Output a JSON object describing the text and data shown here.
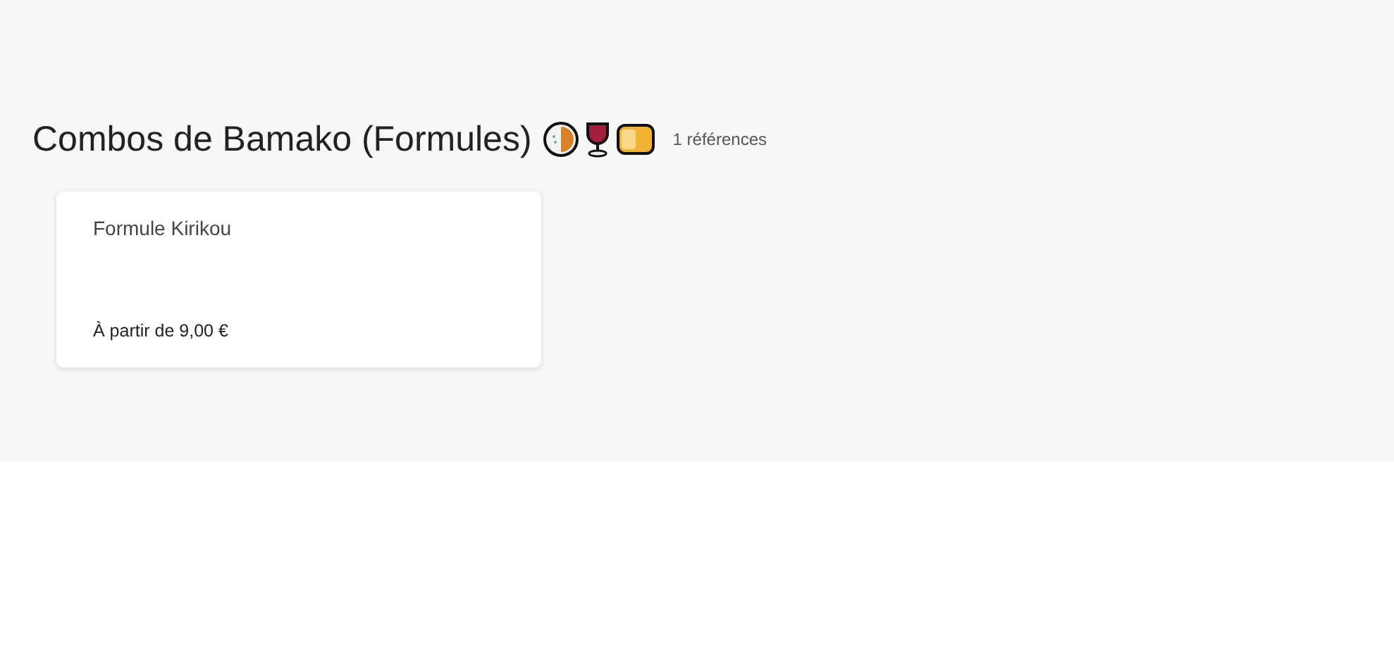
{
  "section": {
    "title": "Combos de Bamako (Formules)",
    "count": "1 références"
  },
  "items": [
    {
      "name": "Formule Kirikou",
      "price": "À partir de 9,00 €"
    }
  ]
}
